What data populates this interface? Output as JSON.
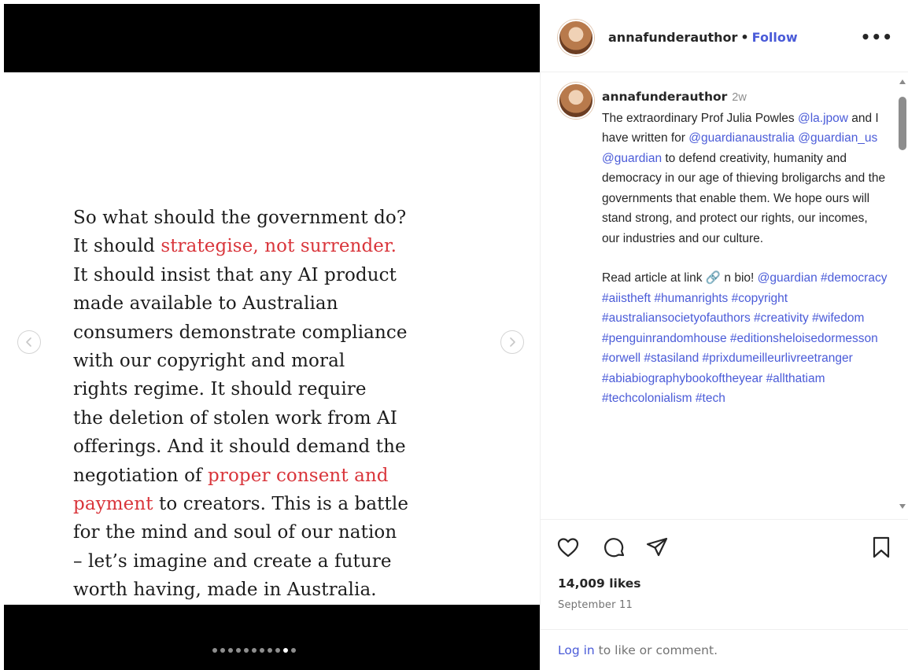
{
  "media": {
    "quote_lines": [
      [
        {
          "text": "So what should the government do?",
          "red": false
        }
      ],
      [
        {
          "text": "It should ",
          "red": false
        },
        {
          "text": "strategise, not surrender.",
          "red": true
        }
      ],
      [
        {
          "text": "It should insist that any AI product",
          "red": false
        }
      ],
      [
        {
          "text": "made available to Australian",
          "red": false
        }
      ],
      [
        {
          "text": "consumers demonstrate compliance",
          "red": false
        }
      ],
      [
        {
          "text": "with our copyright and moral",
          "red": false
        }
      ],
      [
        {
          "text": "rights regime. It should require",
          "red": false
        }
      ],
      [
        {
          "text": "the deletion of stolen work from AI",
          "red": false
        }
      ],
      [
        {
          "text": "offerings. And it should demand the",
          "red": false
        }
      ],
      [
        {
          "text": "negotiation of ",
          "red": false
        },
        {
          "text": "proper consent and",
          "red": true
        }
      ],
      [
        {
          "text": "payment",
          "red": true
        },
        {
          "text": " to creators. This is a battle",
          "red": false
        }
      ],
      [
        {
          "text": "for the mind and soul of our nation",
          "red": false
        }
      ],
      [
        {
          "text": "– let’s imagine and create a future",
          "red": false
        }
      ],
      [
        {
          "text": "worth having, made in Australia.",
          "red": false
        }
      ]
    ],
    "carousel_count": 11,
    "carousel_active_index": 9,
    "colors": {
      "quote_text": "#1c1c1c",
      "highlight": "#d9353b",
      "frame": "#000000"
    }
  },
  "header": {
    "username": "annafunderauthor",
    "separator": "•",
    "follow_label": "Follow",
    "more_label": "•••"
  },
  "caption": {
    "username": "annafunderauthor",
    "time": "2w",
    "segments": [
      {
        "text": "The extraordinary Prof Julia Powles ",
        "link": false
      },
      {
        "text": "@la.jpow",
        "link": true
      },
      {
        "text": " and I have written for ",
        "link": false
      },
      {
        "text": "@guardianaustralia",
        "link": true
      },
      {
        "text": " ",
        "link": false
      },
      {
        "text": "@guardian_us",
        "link": true
      },
      {
        "text": " ",
        "link": false
      },
      {
        "text": "@guardian",
        "link": true
      },
      {
        "text": " to defend creativity, humanity and democracy in our age of thieving broligarchs and the governments that enable them. We hope ours will stand strong, and protect our rights, our incomes, our industries and our culture.",
        "link": false
      }
    ],
    "second_paragraph": [
      {
        "text": "Read article at link 🔗 n bio! ",
        "link": false
      },
      {
        "text": "@guardian",
        "link": true
      },
      {
        "text": " ",
        "link": false
      },
      {
        "text": "#democracy",
        "link": true
      },
      {
        "text": " ",
        "link": false
      },
      {
        "text": "#aiistheft",
        "link": true
      },
      {
        "text": " ",
        "link": false
      },
      {
        "text": "#humanrights",
        "link": true
      },
      {
        "text": " ",
        "link": false
      },
      {
        "text": "#copyright",
        "link": true
      },
      {
        "text": " ",
        "link": false
      },
      {
        "text": "#australiansocietyofauthors",
        "link": true
      },
      {
        "text": " ",
        "link": false
      },
      {
        "text": "#creativity",
        "link": true
      },
      {
        "text": " ",
        "link": false
      },
      {
        "text": "#wifedom",
        "link": true
      },
      {
        "text": " ",
        "link": false
      },
      {
        "text": "#penguinrandomhouse",
        "link": true
      },
      {
        "text": " ",
        "link": false
      },
      {
        "text": "#editionsheloisedormesson",
        "link": true
      },
      {
        "text": " ",
        "link": false
      },
      {
        "text": "#orwell",
        "link": true
      },
      {
        "text": " ",
        "link": false
      },
      {
        "text": "#stasiland",
        "link": true
      },
      {
        "text": " ",
        "link": false
      },
      {
        "text": "#prixdumeilleurlivreetranger",
        "link": true
      },
      {
        "text": " ",
        "link": false
      },
      {
        "text": "#abiabiographybookoftheyear",
        "link": true
      },
      {
        "text": " ",
        "link": false
      },
      {
        "text": "#allthatiam",
        "link": true
      },
      {
        "text": " ",
        "link": false
      },
      {
        "text": "#techcolonialism",
        "link": true
      },
      {
        "text": " ",
        "link": false
      },
      {
        "text": "#tech",
        "link": true
      }
    ]
  },
  "actions": {
    "like_icon": "heart-icon",
    "comment_icon": "comment-icon",
    "share_icon": "paper-plane-icon",
    "save_icon": "bookmark-icon"
  },
  "likes": "14,009 likes",
  "date": "September 11",
  "login": {
    "link_label": "Log in",
    "rest": " to like or comment."
  },
  "colors": {
    "link": "#4a5bd8",
    "muted": "#737373"
  }
}
